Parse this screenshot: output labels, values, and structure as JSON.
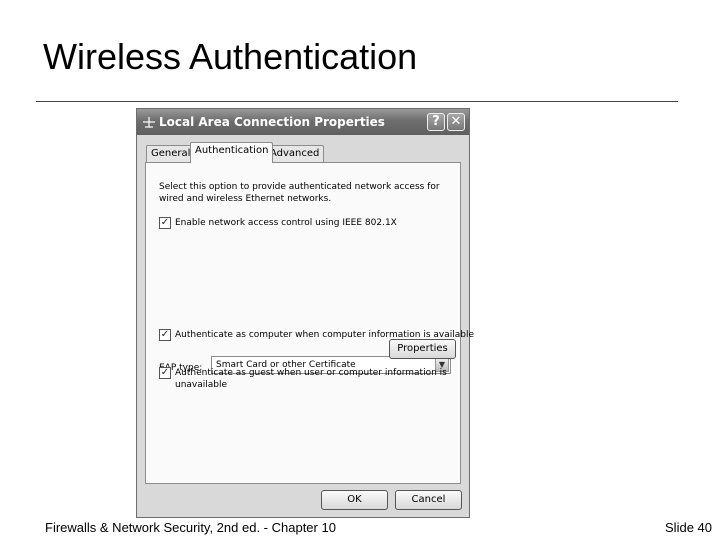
{
  "slide": {
    "title": "Wireless Authentication",
    "footer_left": "Firewalls & Network Security, 2nd ed. - Chapter 10",
    "footer_right": "Slide 40"
  },
  "dialog": {
    "title": "Local Area Connection Properties",
    "help_glyph": "?",
    "close_glyph": "✕",
    "tabs": [
      "General",
      "Authentication",
      "Advanced"
    ],
    "active_tab": "Authentication",
    "description": "Select this option to provide authenticated network access for wired and wireless Ethernet networks.",
    "enable_8021x": {
      "label": "Enable network access control using IEEE 802.1X",
      "checked": true
    },
    "eap_type_label": "EAP type:",
    "eap_type_value": "Smart Card or other Certificate",
    "properties_label": "Properties",
    "auth_as_computer": {
      "label": "Authenticate as computer when computer information is available",
      "checked": true
    },
    "auth_as_guest": {
      "label": "Authenticate as guest when user or computer information is unavailable",
      "checked": true
    },
    "ok_label": "OK",
    "cancel_label": "Cancel"
  },
  "icons": {
    "network": "network-connection-icon",
    "check_mark": "✓",
    "dropdown": "▼"
  }
}
